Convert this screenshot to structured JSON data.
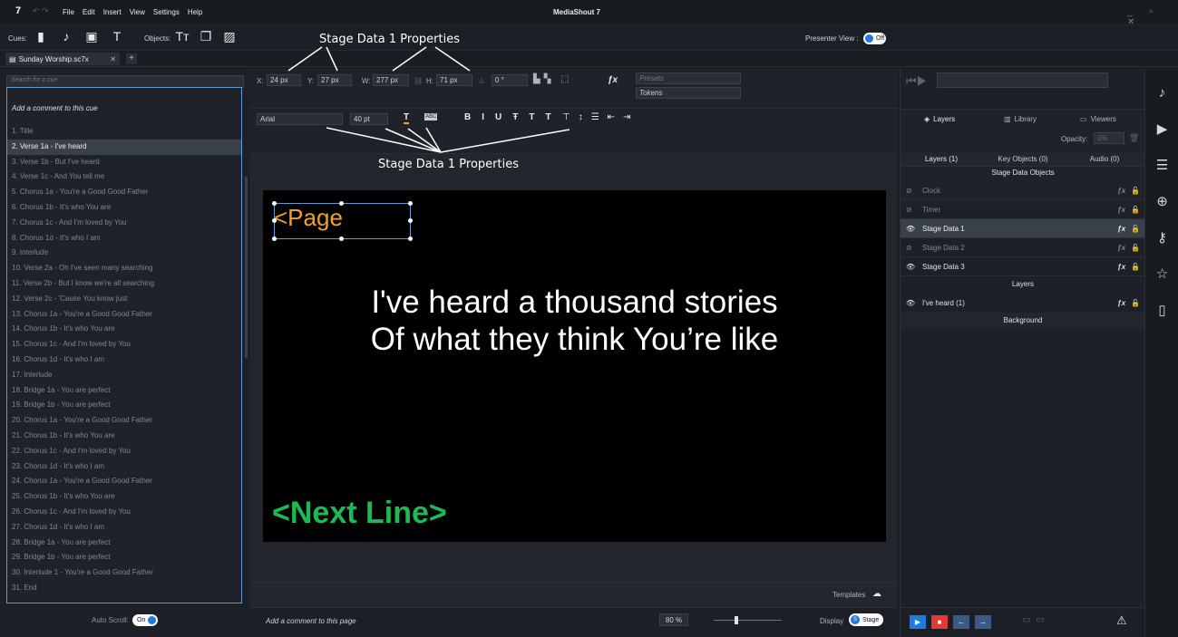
{
  "app": {
    "logo": "7",
    "title": "MediaShout 7",
    "menu": [
      "File",
      "Edit",
      "Insert",
      "View",
      "Settings",
      "Help"
    ]
  },
  "toolbar": {
    "cues_label": "Cues:",
    "objects_label": "Objects:",
    "presenter_view_label": "Presenter View :",
    "presenter_view_state": "Off"
  },
  "tab": {
    "label": "Sunday Worship.sc7x"
  },
  "cuepane": {
    "search_placeholder": "Search for a cue",
    "comment": "Add a comment to this cue",
    "auto_scroll_label": "Auto Scroll:",
    "auto_scroll_state": "On",
    "cues": [
      "1. Title",
      "2. Verse 1a - I've heard",
      "3. Verse 1b - But I've heard",
      "4. Verse 1c - And You tell me",
      "5. Chorus 1a - You're a Good Good Father",
      "6. Chorus 1b - It's who You are",
      "7. Chorus 1c - And I'm loved by You",
      "8. Chorus 1d - It's who I am",
      "9. Interlude",
      "10. Verse 2a - Oh I've seen many searching",
      "11. Verse 2b - But I know we're all searching",
      "12. Verse 2c - 'Cause You know just",
      "13. Chorus 1a - You're a Good Good Father",
      "14. Chorus 1b - It's who You are",
      "15. Chorus 1c - And I'm loved by You",
      "16. Chorus 1d - It's who I am",
      "17. Interlude",
      "18. Bridge 1a - You are perfect",
      "19. Bridge 1b - You are perfect",
      "20. Chorus 1a - You're a Good Good Father",
      "21. Chorus 1b - It's who You are",
      "22. Chorus 1c - And I'm loved by You",
      "23. Chorus 1d - It's who I am",
      "24. Chorus 1a - You're a Good Good Father",
      "25. Chorus 1b - It's who You are",
      "26. Chorus 1c - And I'm loved by You",
      "27. Chorus 1d - It's who I am",
      "28. Bridge 1a - You are perfect",
      "29. Bridge 1b - You are perfect",
      "30. Interlude 1 - You're a Good Good Father",
      "31. End"
    ],
    "active_index": 1
  },
  "props": {
    "x_label": "X:",
    "x": "24 px",
    "y_label": "Y:",
    "y": "27 px",
    "w_label": "W:",
    "w": "277 px",
    "h_label": "H:",
    "h": "71 px",
    "rotation": "0 °",
    "presets": "Presets",
    "tokens": "Tokens",
    "font": "Arial",
    "size": "40 pt"
  },
  "annotations": {
    "top": "Stage Data 1 Properties",
    "bottom": "Stage Data 1 Properties"
  },
  "canvas": {
    "page_token": "<Page",
    "lyric_line1": "I've heard a thousand stories",
    "lyric_line2": "Of what they think You’re like",
    "next_line": "<Next Line>",
    "page_color": "#f0a31c",
    "next_color": "#1db954"
  },
  "bottombar": {
    "comment": "Add a comment to this page",
    "templates": "Templates",
    "zoom": "80 %",
    "display_label": "Display",
    "display_target": "Stage"
  },
  "right": {
    "tabs": [
      "Layers",
      "Library",
      "Viewers"
    ],
    "opacity_label": "Opacity:",
    "opacity_value": "0%",
    "subtabs": [
      "Layers (1)",
      "Key Objects (0)",
      "Audio (0)"
    ],
    "stage_header": "Stage Data Objects",
    "stage_items": [
      "Clock",
      "Timer",
      "Stage Data 1",
      "Stage Data 2",
      "Stage Data 3"
    ],
    "layers_header": "Layers",
    "layer_item": "I've heard (1)",
    "background": "Background"
  }
}
